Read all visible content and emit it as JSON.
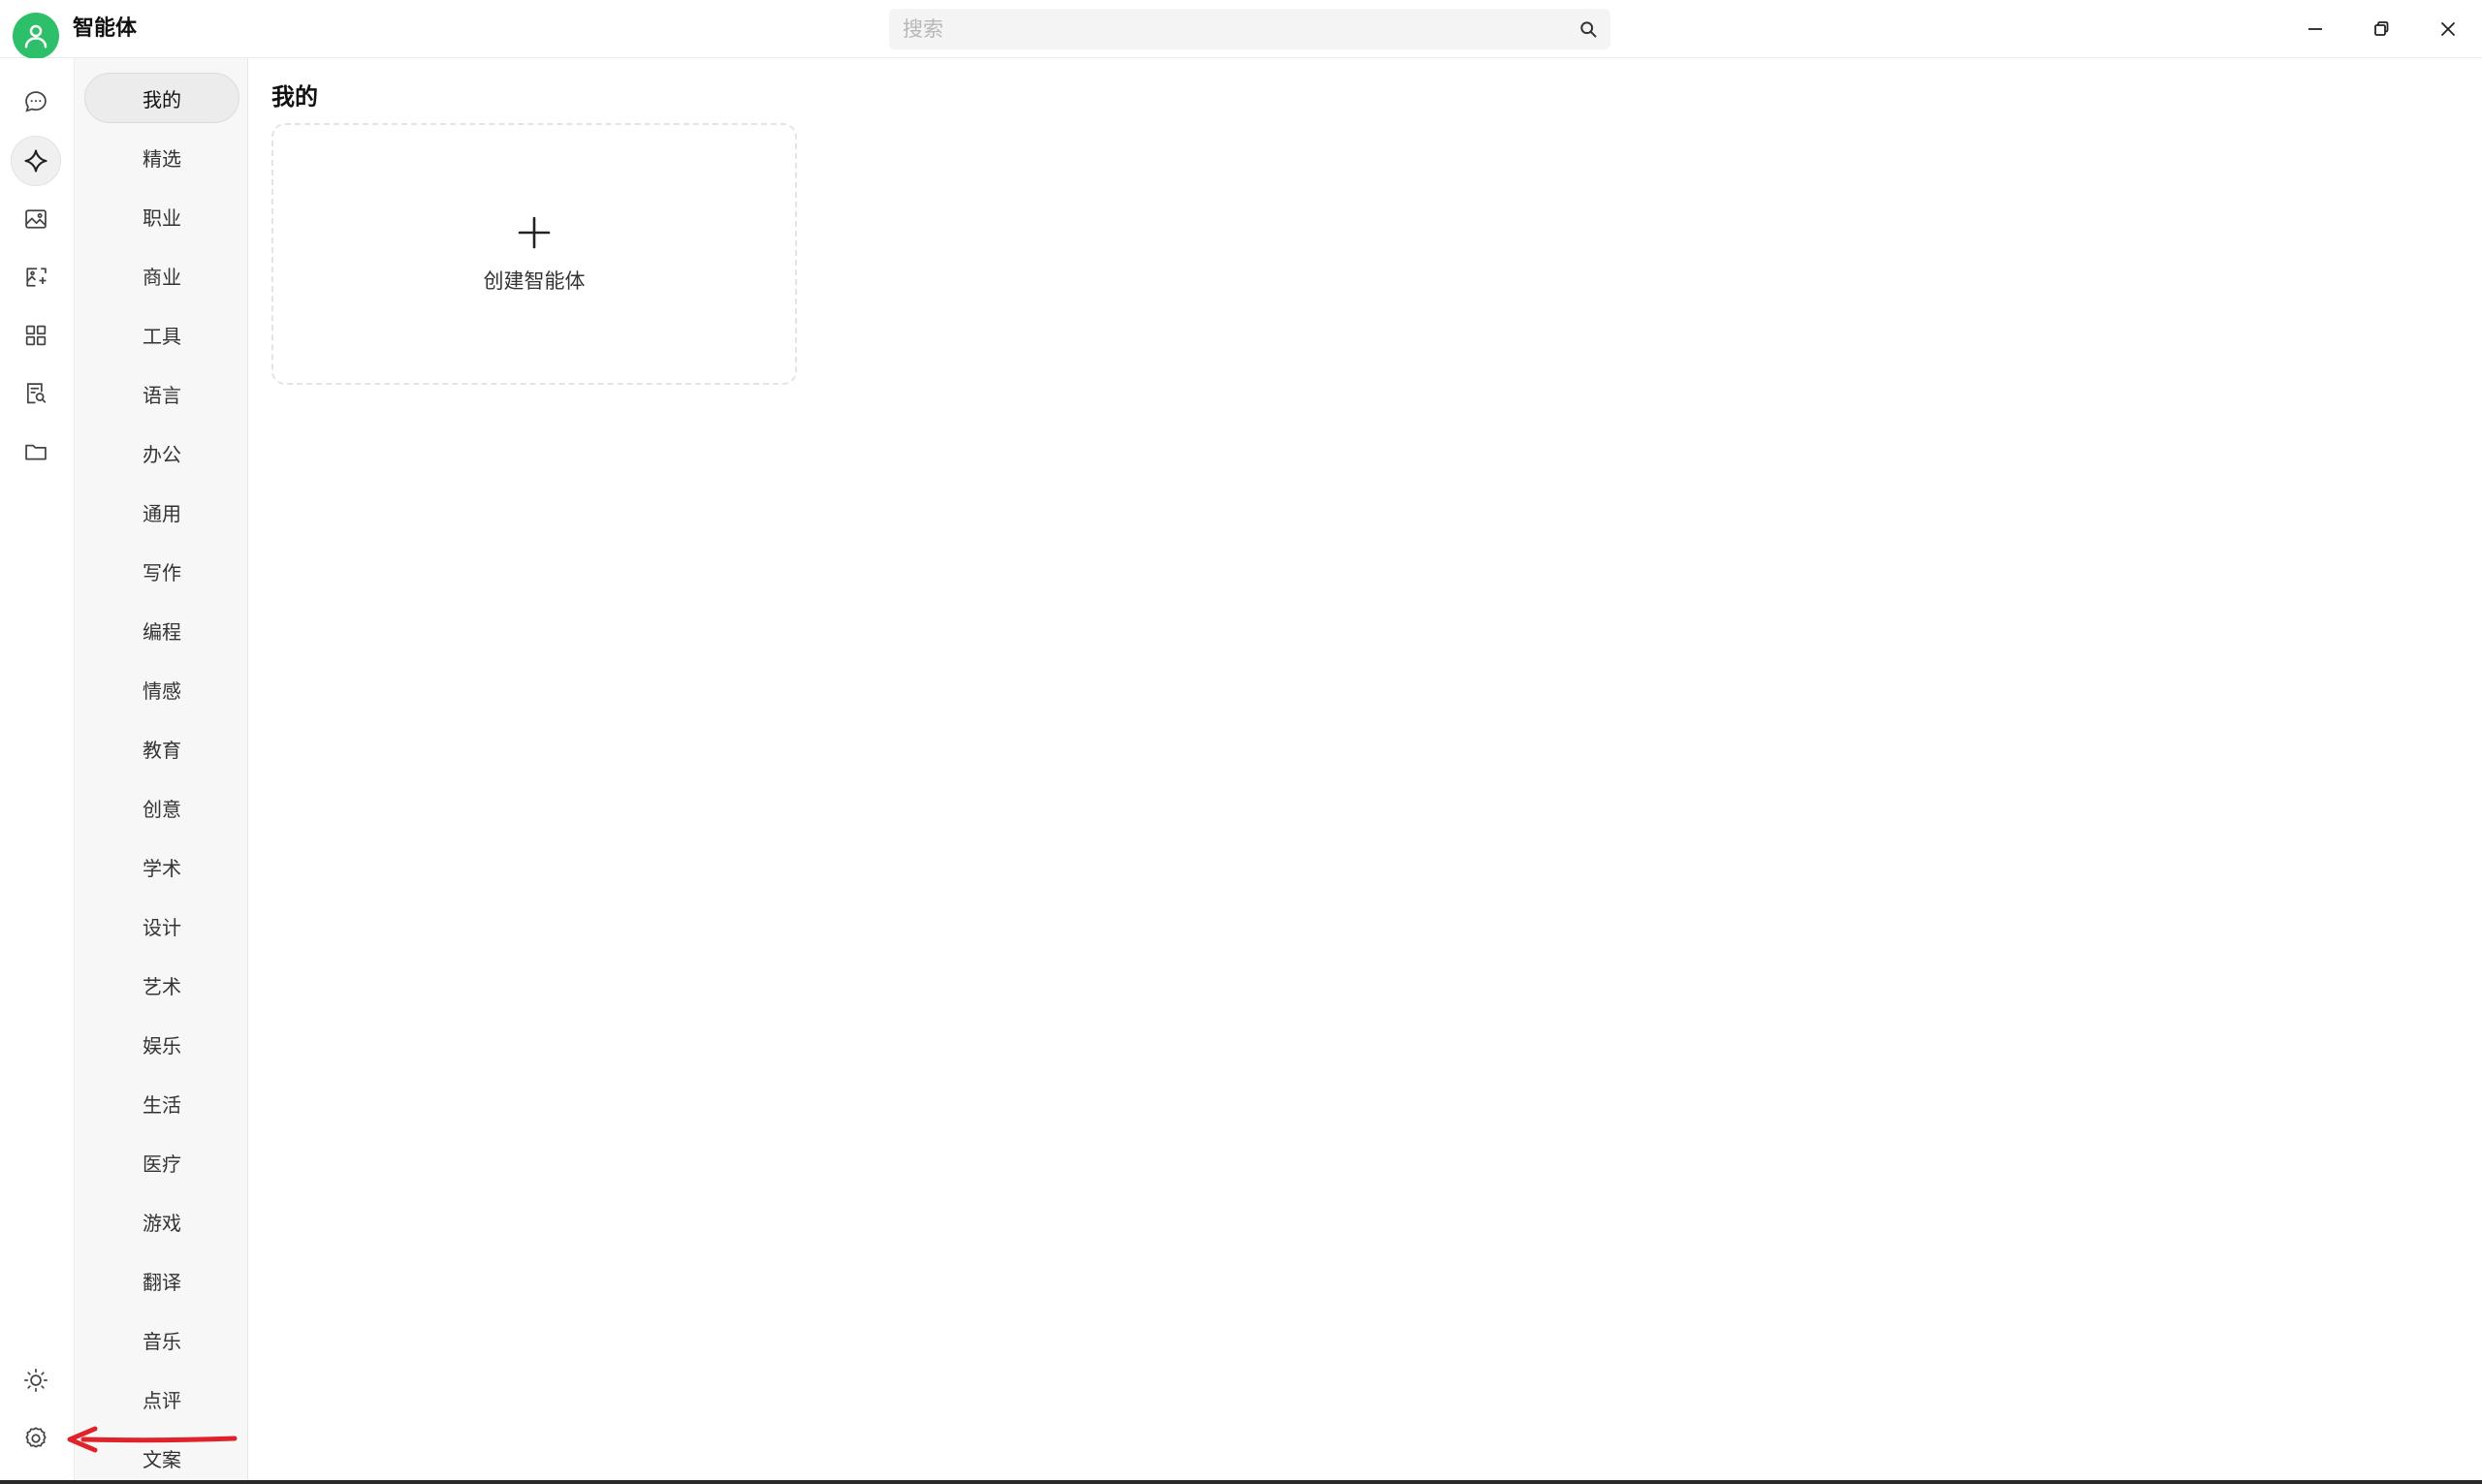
{
  "app": {
    "title": "智能体"
  },
  "search": {
    "placeholder": "搜索",
    "value": ""
  },
  "window_controls": {
    "minimize_icon": "minimize-icon",
    "restore_icon": "restore-icon",
    "close_icon": "close-icon"
  },
  "rail": {
    "items": [
      {
        "id": "chat",
        "icon": "chat-bubble-icon",
        "active": false
      },
      {
        "id": "agents",
        "icon": "sparkle-icon",
        "active": true
      },
      {
        "id": "image",
        "icon": "image-icon",
        "active": false
      },
      {
        "id": "image-edit",
        "icon": "image-edit-icon",
        "active": false
      },
      {
        "id": "apps",
        "icon": "grid-icon",
        "active": false
      },
      {
        "id": "doc-search",
        "icon": "document-search-icon",
        "active": false
      },
      {
        "id": "folder",
        "icon": "folder-icon",
        "active": false
      }
    ],
    "bottom": [
      {
        "id": "theme",
        "icon": "sun-icon"
      },
      {
        "id": "settings",
        "icon": "gear-icon"
      }
    ]
  },
  "categories": {
    "items": [
      {
        "label": "我的",
        "active": true
      },
      {
        "label": "精选"
      },
      {
        "label": "职业"
      },
      {
        "label": "商业"
      },
      {
        "label": "工具"
      },
      {
        "label": "语言"
      },
      {
        "label": "办公"
      },
      {
        "label": "通用"
      },
      {
        "label": "写作"
      },
      {
        "label": "编程"
      },
      {
        "label": "情感"
      },
      {
        "label": "教育"
      },
      {
        "label": "创意"
      },
      {
        "label": "学术"
      },
      {
        "label": "设计"
      },
      {
        "label": "艺术"
      },
      {
        "label": "娱乐"
      },
      {
        "label": "生活"
      },
      {
        "label": "医疗"
      },
      {
        "label": "游戏"
      },
      {
        "label": "翻译"
      },
      {
        "label": "音乐"
      },
      {
        "label": "点评"
      },
      {
        "label": "文案"
      }
    ]
  },
  "main": {
    "section_title": "我的",
    "create_card": {
      "label": "创建智能体",
      "icon": "plus-icon"
    }
  },
  "colors": {
    "avatar": "#2dbf6a",
    "annotation_arrow": "#e0222b",
    "active_bg": "#ececec"
  }
}
